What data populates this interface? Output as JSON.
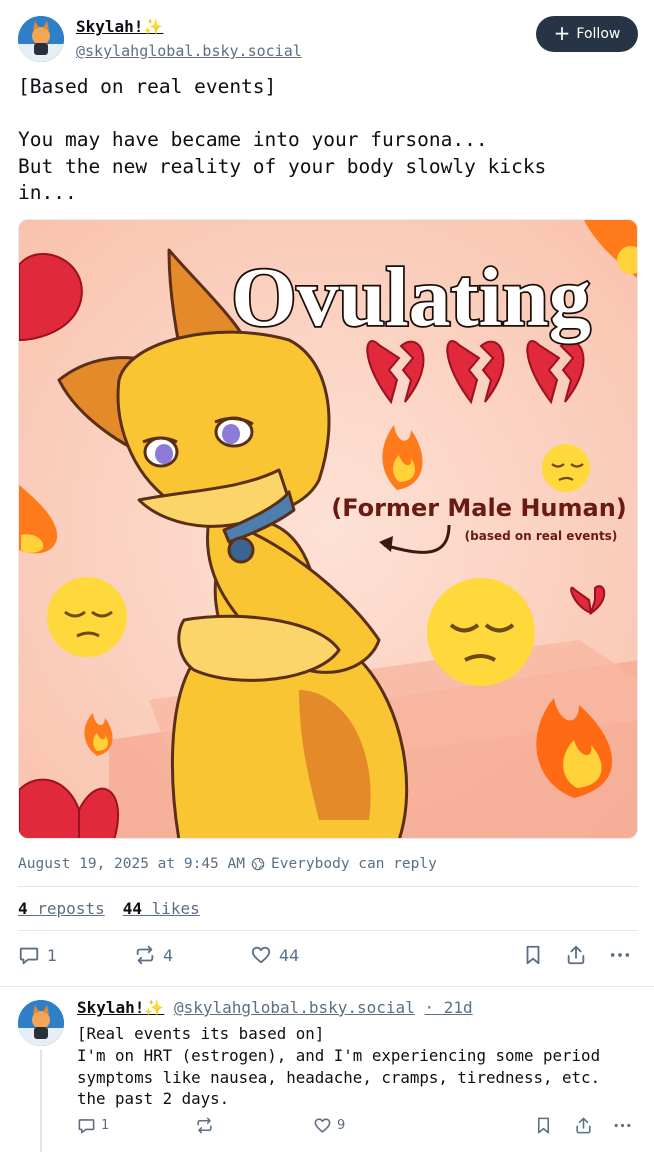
{
  "post": {
    "author": {
      "display_name": "Skylah!✨",
      "handle": "@skylahglobal.bsky.social"
    },
    "follow_label": "Follow",
    "text": "[Based on real events]\n\nYou may have became into your fursona...\nBut the new reality of your body slowly kicks\nin...",
    "image": {
      "title_text": "Ovulating",
      "subtitle_text": "(Former Male Human)",
      "caption_text": "(based on real events)",
      "emojis": [
        "💔",
        "🔥",
        "😔"
      ]
    },
    "timestamp": "August 19, 2025 at 9:45 AM",
    "reply_setting": "Everybody can reply",
    "stats": {
      "reposts_count": "4",
      "reposts_label": "reposts",
      "likes_count": "44",
      "likes_label": "likes"
    },
    "actions": {
      "reply_count": "1",
      "repost_count": "4",
      "like_count": "44"
    }
  },
  "reply": {
    "author": {
      "display_name": "Skylah!✨",
      "handle": "@skylahglobal.bsky.social",
      "time_ago": "· 21d"
    },
    "text": "[Real events its based on]\nI'm on HRT (estrogen), and I'm experiencing some period\nsymptoms like nausea, headache, cramps, tiredness, etc.\nthe past 2 days.",
    "actions": {
      "reply_count": "1",
      "repost_count": "",
      "like_count": "9"
    }
  },
  "colors": {
    "follow_bg": "#263445",
    "muted_text": "#5b6f85",
    "image_bg": "#fbd3c2",
    "fur_yellow": "#f9c533",
    "fur_orange": "#e58a2b",
    "collar_blue": "#4c7fb0"
  },
  "icons": {
    "follow": "plus-icon",
    "reply_setting": "globe-icon",
    "reply": "speech-bubble-icon",
    "repost": "repost-arrows-icon",
    "like": "heart-icon",
    "bookmark": "bookmark-icon",
    "share": "share-icon",
    "more": "ellipsis-icon"
  }
}
